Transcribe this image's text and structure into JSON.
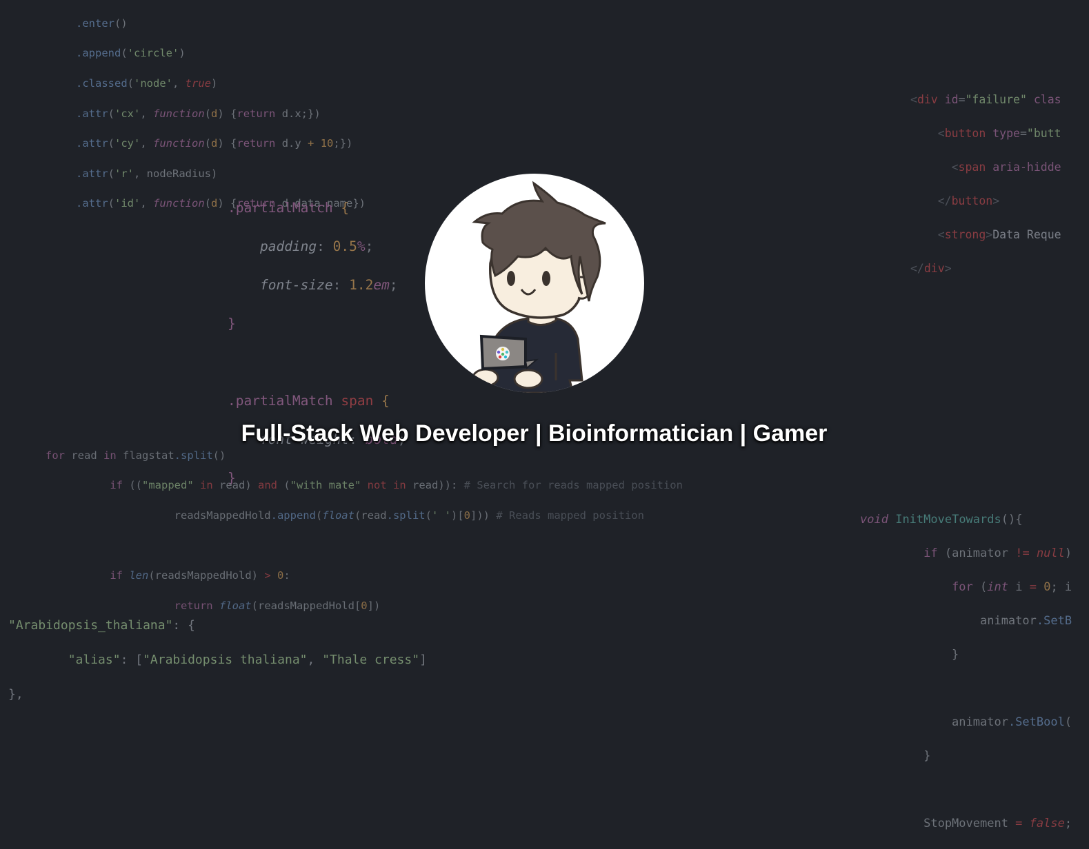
{
  "hero": {
    "headline": "Full-Stack Web Developer | Bioinformatician | Gamer",
    "avatar_alt": "cartoon avatar holding laptop"
  },
  "background_code": {
    "d3": [
      ".enter()",
      ".append('circle')",
      ".classed('node', true)",
      ".attr('cx', function(d) {return d.x;})",
      ".attr('cy', function(d) {return d.y + 10;})",
      ".attr('r', nodeRadius)",
      ".attr('id', function(d) {return d.data.name})"
    ],
    "html": [
      "<div id=\"failure\" clas",
      "    <button type=\"butt",
      "      <span aria-hidde",
      "    </button>",
      "    <strong>Data Reque",
      "</div>"
    ],
    "css": [
      ".partialMatch {",
      "    padding: 0.5%;",
      "    font-size: 1.2em;",
      "}",
      "",
      ".partialMatch span {",
      "    font-weight: bold;",
      "}"
    ],
    "python": [
      "for read in flagstat.split()",
      "        if ((\"mapped\" in read) and (\"with mate\" not in read)): # Search for reads mapped position",
      "                readsMappedHold.append(float(read.split(' ')[0])) # Reads mapped position",
      "",
      "        if len(readsMappedHold) > 0:",
      "                return float(readsMappedHold[0])"
    ],
    "json": [
      "\"Arabidopsis_thaliana\": {",
      "        \"alias\": [\"Arabidopsis thaliana\", \"Thale cress\"]",
      "},"
    ],
    "csharp": [
      "void InitMoveTowards(){",
      "         if (animator != null)",
      "             for (int i = 0; i",
      "                 animator.SetB",
      "             }",
      "",
      "             animator.SetBool(",
      "         }",
      "",
      "         StopMovement = false;"
    ]
  }
}
